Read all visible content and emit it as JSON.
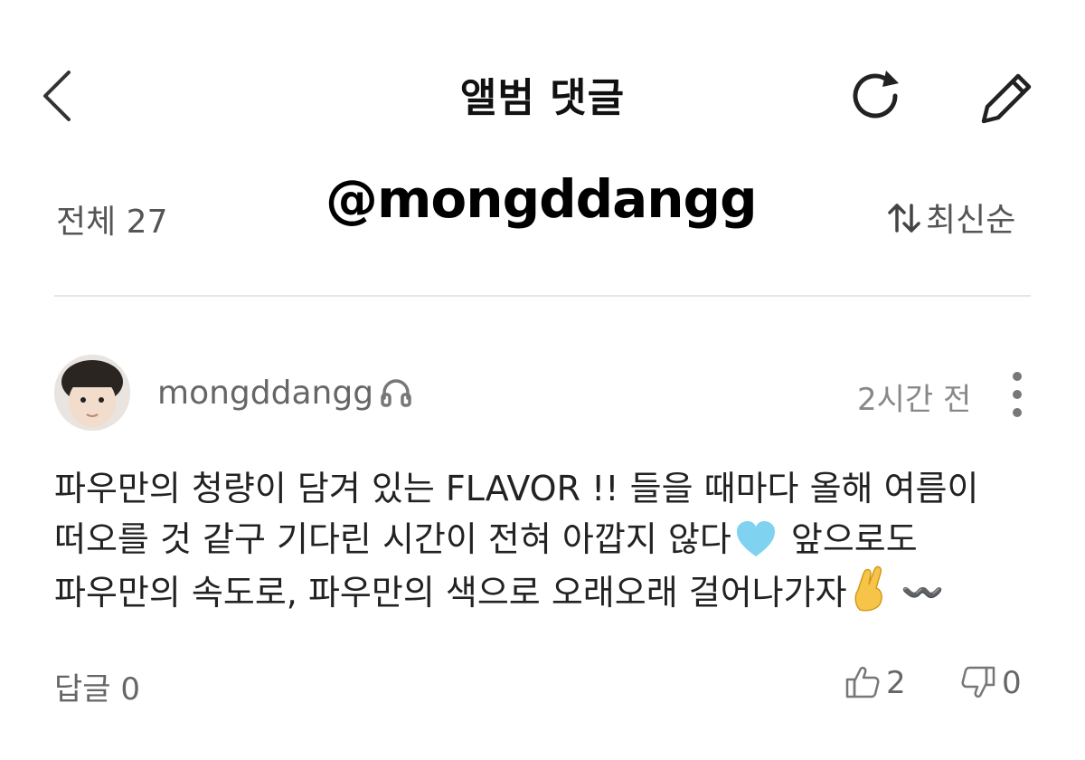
{
  "header": {
    "title": "앨범 댓글",
    "back_icon": "chevron-left-icon",
    "refresh_icon": "refresh-icon",
    "edit_icon": "pencil-icon"
  },
  "watermark": "@mongddangg",
  "list": {
    "count_label": "전체 27",
    "sort_label": "최신순",
    "sort_icon": "sort-arrows-icon"
  },
  "comment": {
    "username": "mongddangg",
    "user_badge_icon": "headphone-icon",
    "time": "2시간 전",
    "more_icon": "more-vertical-icon",
    "text_part1": "파우만의 청량이 담겨 있는 FLAVOR !! 들을 때마다 올해 여름이 떠오를 것 같구 기다린 시간이 전혀 아깝지 않다",
    "emoji1": "light-blue-heart-icon",
    "text_part2": "앞으로도 파우만의 속도로, 파우만의 색으로 오래오래 걸어나가자",
    "emoji2": "crossed-fingers-icon",
    "text_part3": "〰️",
    "reply_label": "답글 0",
    "like_count": "2",
    "dislike_count": "0"
  },
  "colors": {
    "background": "#ffffff",
    "text_primary": "#222222",
    "text_secondary": "#666666",
    "divider": "#e6e6e6"
  }
}
